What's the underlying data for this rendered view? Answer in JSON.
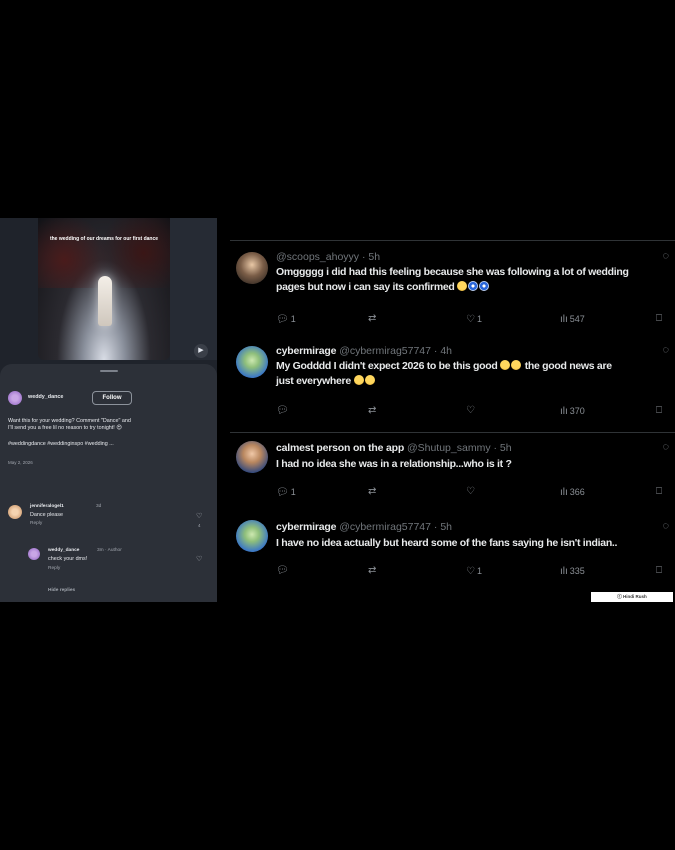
{
  "insta": {
    "video_caption": "the wedding of our dreams for our first dance",
    "username": "weddy_dance",
    "follow_label": "Follow",
    "caption_line1": "Want this for your wedding? Comment \"Dance\" and",
    "caption_line2": "I'll send you a free lil no reason to try tonight! 😍",
    "hashtags": "#weddingdance #weddinginspo #wedding ...",
    "date": "May 2, 2026",
    "comments": [
      {
        "user": "jenniferalogel1",
        "time": "3d",
        "text": "Dance please",
        "reply_label": "Reply"
      },
      {
        "user": "weddy_dance",
        "time": "3m · Author",
        "text": "check your dms!",
        "reply_label": "Reply"
      }
    ],
    "comment_like_count": "4",
    "hide_replies_label": "Hide replies"
  },
  "tweets": [
    {
      "name": "",
      "handle": "@scoops_ahoyyy",
      "time": "· 5h",
      "line1": "Omggggg i did had this feeling because she was following a lot of wedding",
      "line2": "pages but now i can say its confirmed",
      "replies": "1",
      "retweets": "",
      "likes": "1",
      "views": "547"
    },
    {
      "name": "cybermirage",
      "handle": "@cybermirag57747",
      "time": "· 4h",
      "line1": "My Godddd I didn't expect 2026 to be this good",
      "line1_after": "the good news are",
      "line2": "just everywhere",
      "replies": "",
      "retweets": "",
      "likes": "",
      "views": "370"
    },
    {
      "name": "calmest person on the app",
      "handle": "@Shutup_sammy",
      "time": "· 5h",
      "line1": "I had no idea she was in a relationship...who is it ?",
      "replies": "1",
      "retweets": "",
      "likes": "",
      "views": "366"
    },
    {
      "name": "cybermirage",
      "handle": "@cybermirag57747",
      "time": "· 5h",
      "line1": "I have no idea actually but heard some of the fans saying he isn't indian..",
      "replies": "",
      "retweets": "",
      "likes": "1",
      "views": "335"
    }
  ],
  "watermark": "ⓒ Hindi Rush",
  "icons": [
    "reply-icon",
    "retweet-icon",
    "like-icon",
    "views-icon",
    "bookmark-icon",
    "grok-icon"
  ]
}
